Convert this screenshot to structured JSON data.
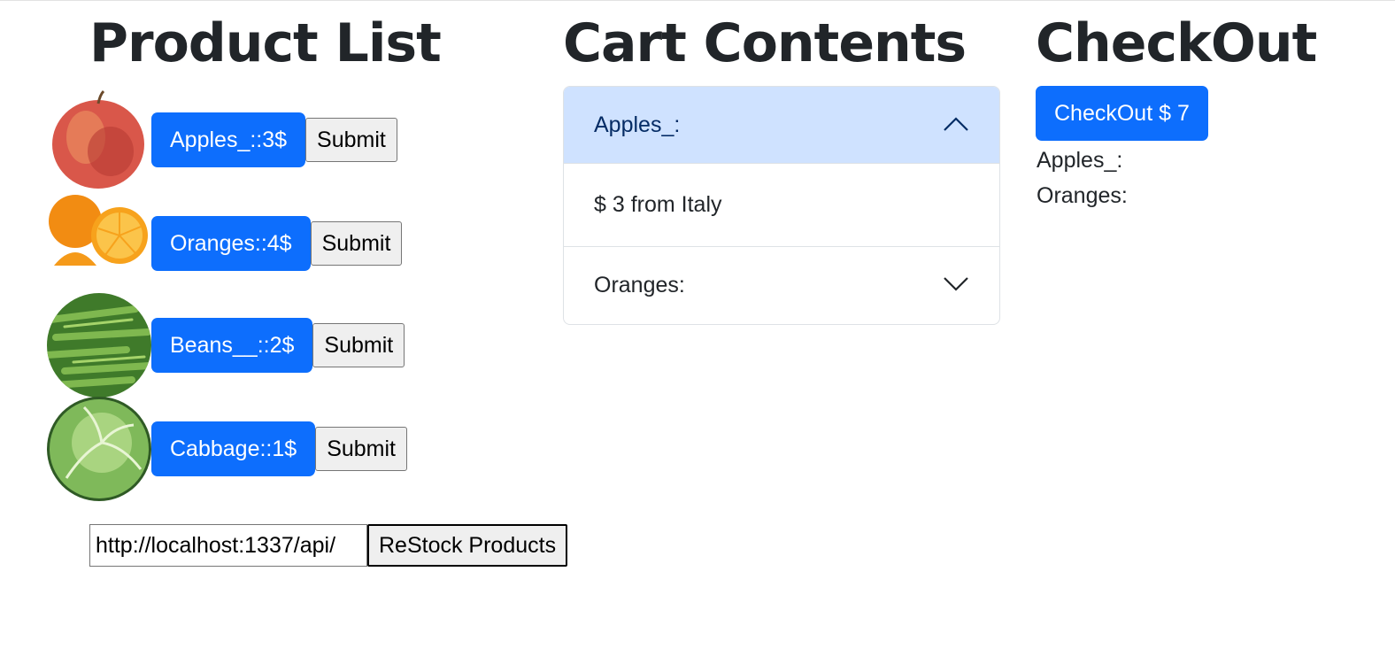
{
  "products_section": {
    "title": "Product List",
    "items": [
      {
        "label": "Apples_::3$",
        "submit": "Submit",
        "image": "apple"
      },
      {
        "label": "Oranges::4$",
        "submit": "Submit",
        "image": "orange"
      },
      {
        "label": "Beans__::2$",
        "submit": "Submit",
        "image": "beans"
      },
      {
        "label": "Cabbage::1$",
        "submit": "Submit",
        "image": "cabbage"
      }
    ],
    "restock_url": "http://localhost:1337/api/",
    "restock_label": "ReStock Products"
  },
  "cart_section": {
    "title": "Cart Contents",
    "items": [
      {
        "label": "Apples_:",
        "detail": "$ 3 from Italy",
        "expanded": true,
        "icon": "chevron-up-icon"
      },
      {
        "label": "Oranges:",
        "expanded": false,
        "icon": "chevron-down-icon"
      }
    ]
  },
  "checkout_section": {
    "title": "CheckOut",
    "button_label": "CheckOut $ 7",
    "items": [
      "Apples_:",
      "Oranges:"
    ]
  },
  "colors": {
    "primary": "#0d6efd",
    "accordion_active_bg": "#cfe2ff",
    "text": "#212529"
  }
}
